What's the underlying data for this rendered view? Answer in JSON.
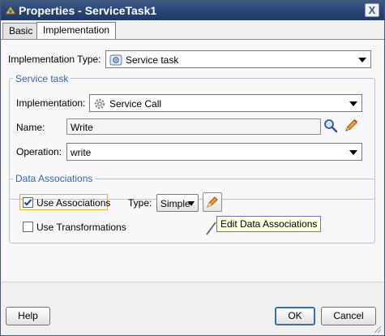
{
  "window": {
    "title": "Properties - ServiceTask1",
    "close_glyph": "X"
  },
  "tabs": [
    {
      "label": "Basic",
      "selected": false
    },
    {
      "label": "Implementation",
      "selected": true
    }
  ],
  "implementation_type": {
    "label": "Implementation Type:",
    "value": "Service task",
    "icon": "service-task-icon"
  },
  "service_task": {
    "title": "Service task",
    "implementation": {
      "label": "Implementation:",
      "value": "Service Call",
      "icon": "gear-icon"
    },
    "name": {
      "label": "Name:",
      "value": "Write"
    },
    "operation": {
      "label": "Operation:",
      "value": "write"
    }
  },
  "data_associations": {
    "title": "Data Associations",
    "use_associations": {
      "label": "Use Associations",
      "checked": true
    },
    "type": {
      "label": "Type:",
      "value": "Simple"
    },
    "use_transformations": {
      "label": "Use Transformations",
      "checked": false
    },
    "tooltip": "Edit Data Associations"
  },
  "footer": {
    "help": "Help",
    "ok": "OK",
    "cancel": "Cancel"
  },
  "colors": {
    "title_bar": "#2a4676",
    "group_title": "#3a66a8",
    "tooltip_bg": "#ffffe1"
  }
}
